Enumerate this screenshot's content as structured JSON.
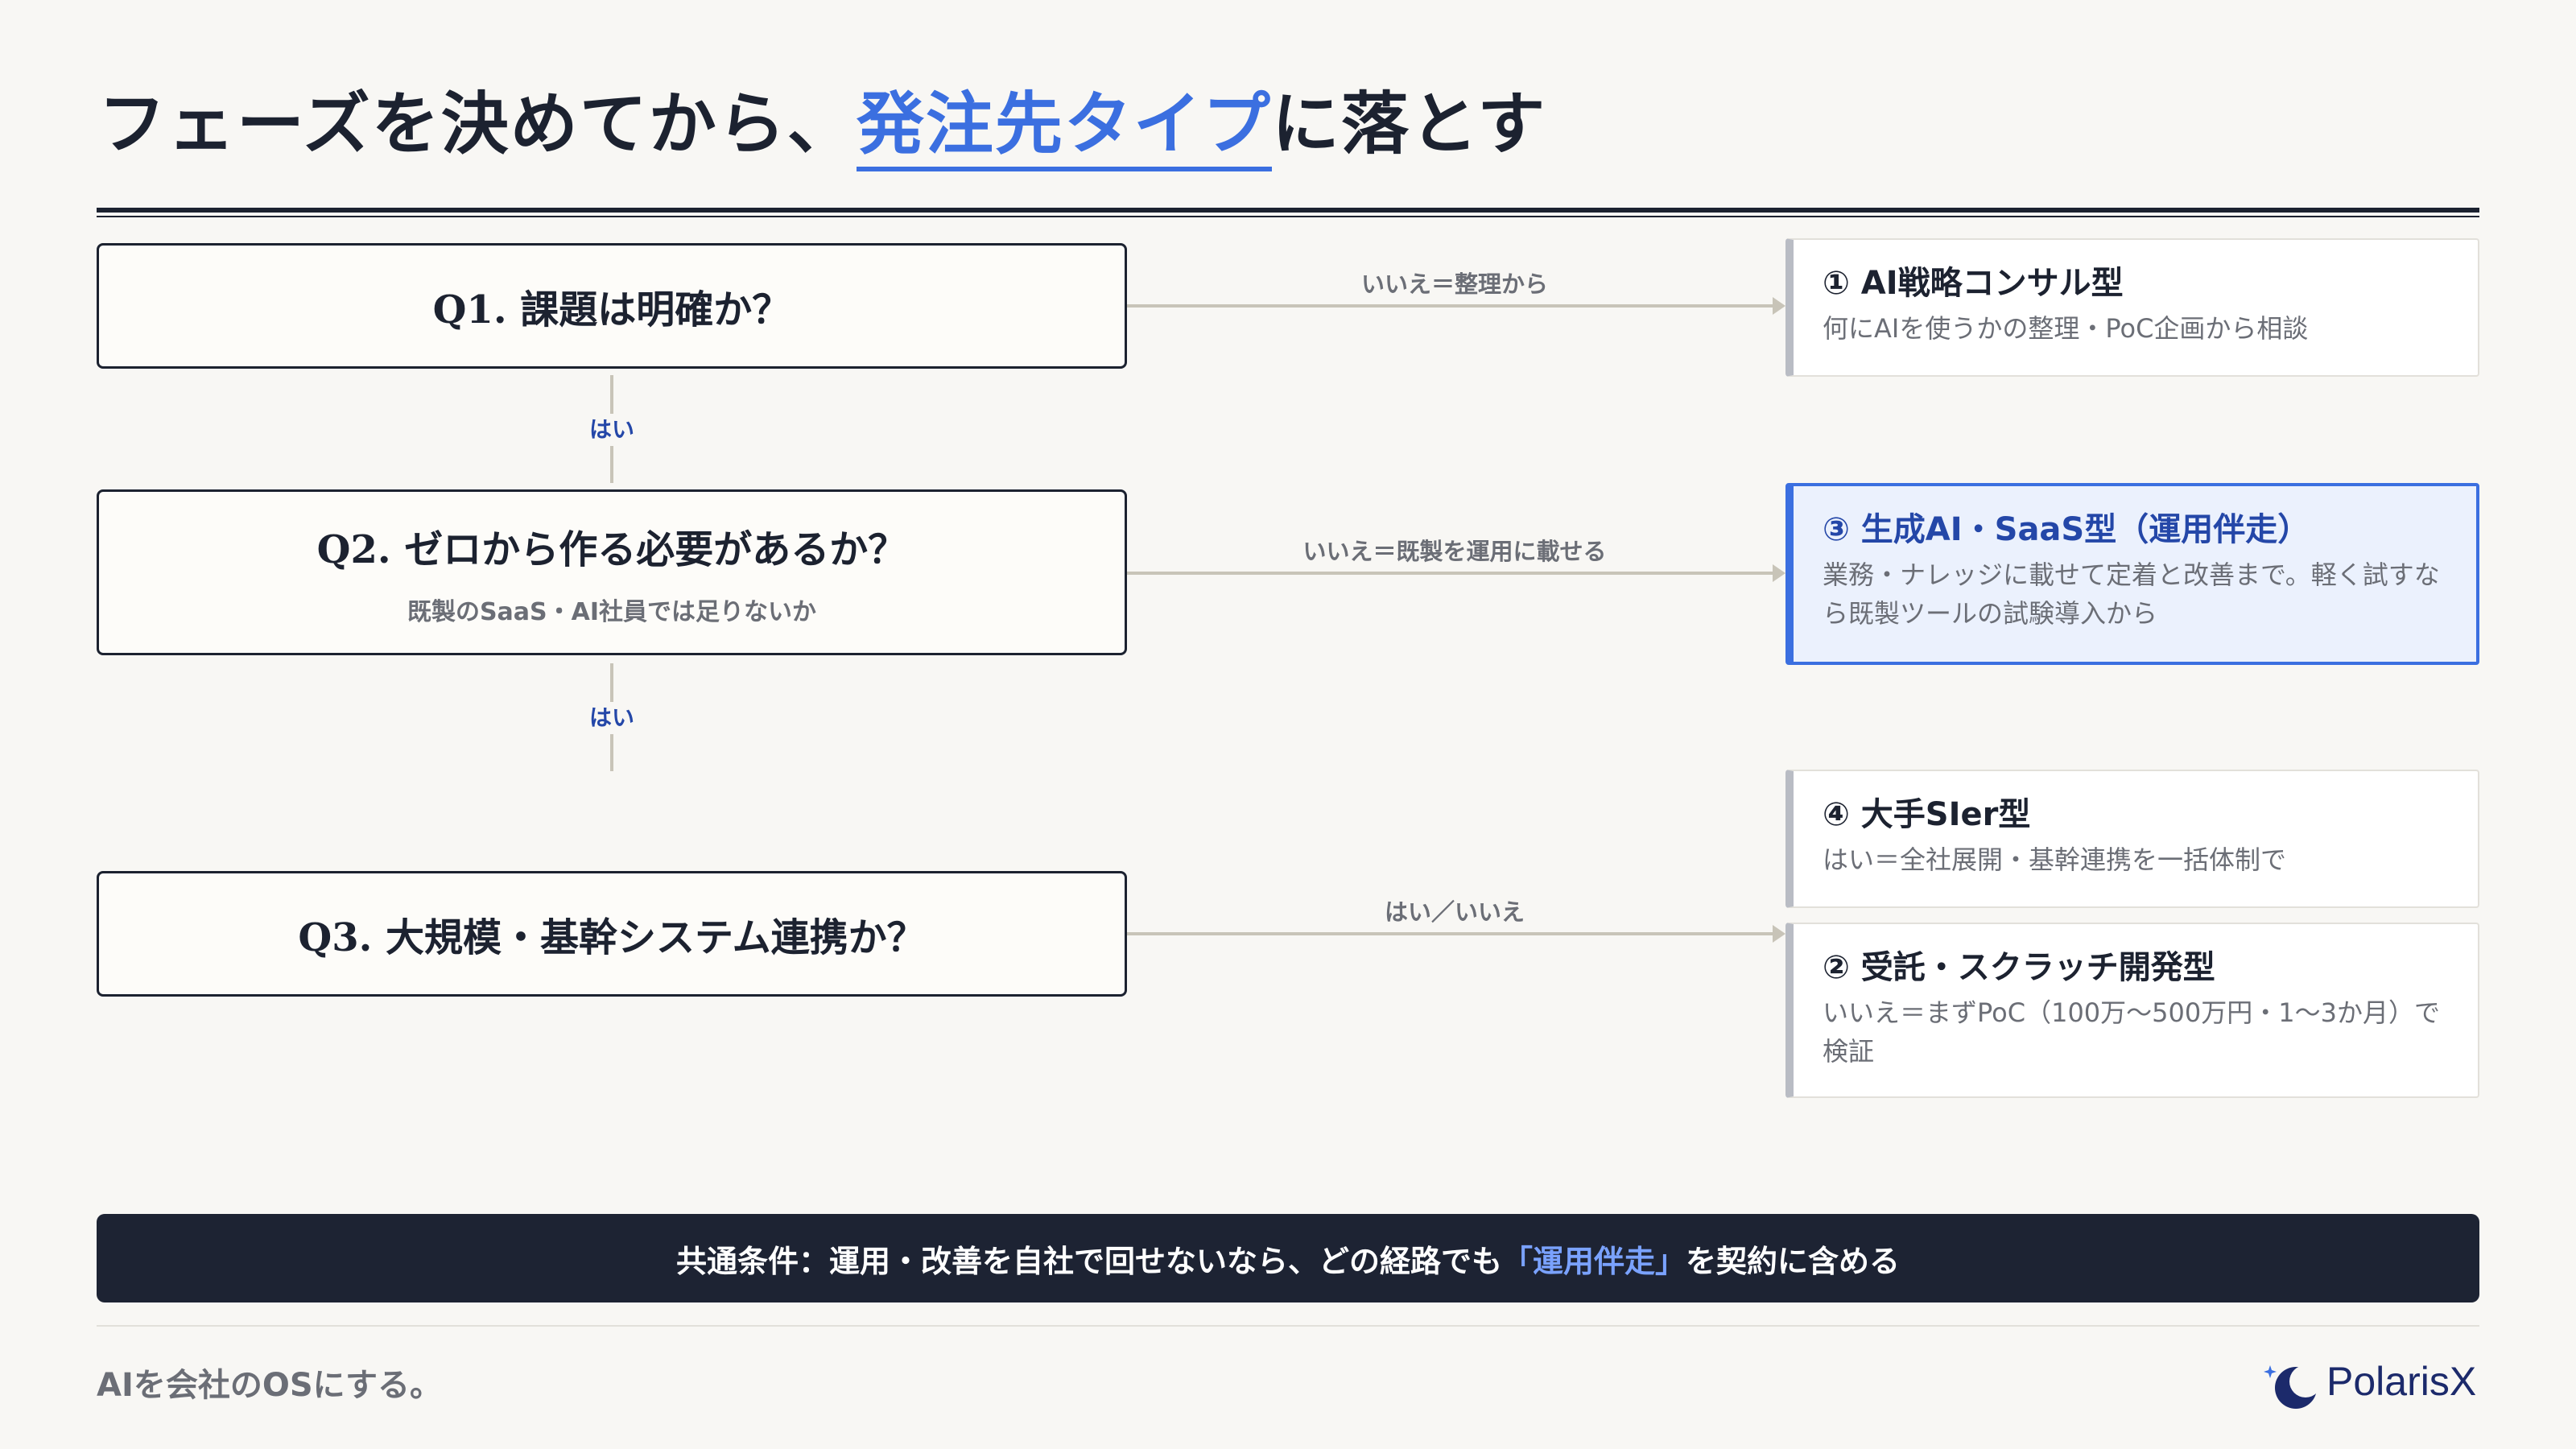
{
  "header": {
    "title_pre": "フェーズを決めてから、",
    "title_accent": "発注先タイプ",
    "title_post": "に落とす"
  },
  "questions": [
    {
      "label": "Q1. 課題は明確か？",
      "sub": ""
    },
    {
      "label": "Q2. ゼロから作る必要があるか？",
      "sub": "既製のSaaS・AI社員では足りないか"
    },
    {
      "label": "Q3. 大規模・基幹システム連携か？",
      "sub": ""
    }
  ],
  "yes_labels": [
    "はい",
    "はい"
  ],
  "arrows": [
    {
      "label": "いいえ＝整理から"
    },
    {
      "label": "いいえ＝既製を運用に載せる"
    },
    {
      "label": "はい／いいえ"
    }
  ],
  "answers": [
    {
      "title": "① AI戦略コンサル型",
      "desc": "何にAIを使うかの整理・PoC企画から相談"
    },
    {
      "title": "③ 生成AI・SaaS型（運用伴走）",
      "desc": "業務・ナレッジに載せて定着と改善まで。軽く試すなら既製ツールの試験導入から"
    },
    {
      "title": "④ 大手SIer型",
      "desc": "はい＝全社展開・基幹連携を一括体制で"
    },
    {
      "title": "② 受託・スクラッチ開発型",
      "desc": "いいえ＝まずPoC（100万〜500万円・1〜3か月）で検証"
    }
  ],
  "banner": {
    "pre": "共通条件：運用・改善を自社で回せないなら、どの経路でも",
    "highlight": "「運用伴走」",
    "post": "を契約に含める"
  },
  "footer": {
    "tagline": "AIを会社のOSにする。",
    "brand": "PolarisX"
  },
  "colors": {
    "accent": "#3b6fe0",
    "dark": "#1c2230",
    "banner_bg": "#1d2333",
    "banner_highlight": "#7aa2ff",
    "connector": "#c8c4b8"
  }
}
